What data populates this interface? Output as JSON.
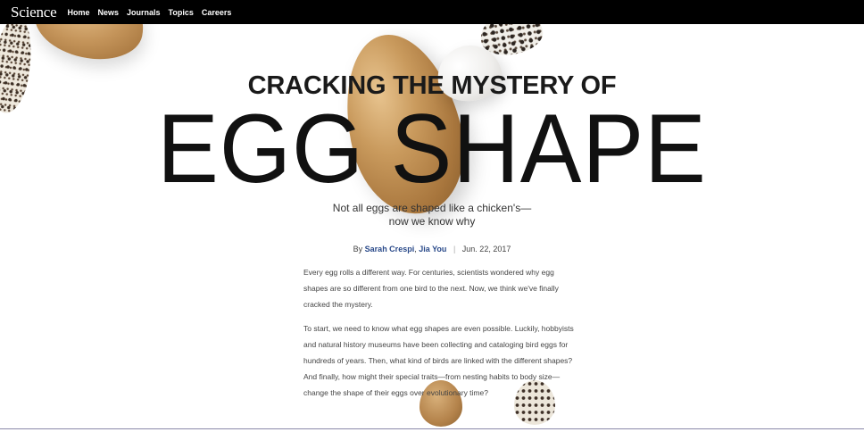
{
  "brand": {
    "logo": "Science"
  },
  "nav": {
    "items": [
      "Home",
      "News",
      "Journals",
      "Topics",
      "Careers"
    ]
  },
  "article": {
    "kicker": "CRACKING THE MYSTERY OF",
    "headline": "EGG SHAPE",
    "dek_line1": "Not all eggs are shaped like a chicken's—",
    "dek_line2": "now we know why",
    "byline_prefix": "By",
    "author1": "Sarah Crespi",
    "author_sep": ",",
    "author2": "Jia You",
    "divider": "|",
    "date": "Jun. 22, 2017",
    "paragraphs": [
      "Every egg rolls a different way. For centuries, scientists wondered why egg shapes are so different from one bird to the next. Now, we think we've finally cracked the mystery.",
      "To start, we need to know what egg shapes are even possible. Luckily, hobbyists and natural history museums have been collecting and cataloging bird eggs for hundreds of years. Then, what kind of birds are linked with the different shapes? And finally, how might their special traits—from nesting habits to body size—change the shape of their eggs over evolutionary time?"
    ]
  },
  "colors": {
    "topbar": "#000000",
    "author_link": "#2a4a8a",
    "text": "#444444"
  }
}
